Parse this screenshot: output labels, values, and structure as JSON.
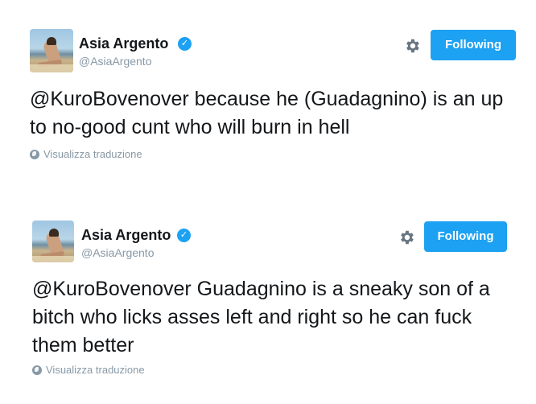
{
  "tweets": [
    {
      "author_name": "Asia Argento",
      "handle": "@AsiaArgento",
      "follow_label": "Following",
      "mention": "@KuroBovenover",
      "body": " because he (Guadagnino) is an up to no-good cunt who will burn in hell",
      "translate_label": "Visualizza traduzione"
    },
    {
      "author_name": "Asia Argento",
      "handle": "@AsiaArgento",
      "follow_label": "Following",
      "mention": "@KuroBovenover",
      "body": " Guadagnino is a sneaky son of a bitch who licks asses left and right so he can fuck them better",
      "translate_label": "Visualizza traduzione"
    }
  ],
  "icons": {
    "verified": "verified-badge-icon",
    "settings": "gear-icon",
    "translate": "globe-icon"
  },
  "colors": {
    "accent": "#1da1f2",
    "text": "#14171a",
    "muted": "#8899a6"
  }
}
